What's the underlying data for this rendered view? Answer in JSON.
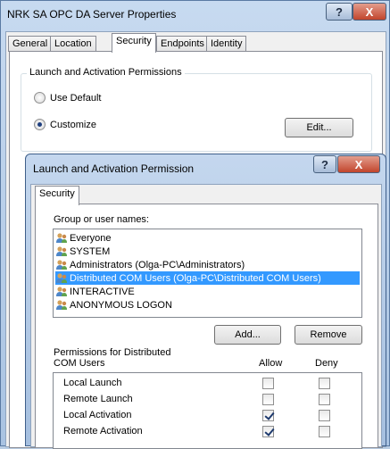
{
  "outer_window": {
    "title": "NRK SA OPC DA Server Properties",
    "help_button": "?",
    "close_button": "X",
    "tabs": [
      "General",
      "Location",
      "Security",
      "Endpoints",
      "Identity"
    ],
    "active_tab": "Security",
    "group_title": "Launch and Activation Permissions",
    "radio_use_default": "Use Default",
    "radio_customize": "Customize",
    "selected_radio": "Customize",
    "edit_button": "Edit..."
  },
  "dialog": {
    "title": "Launch and Activation Permission",
    "help_button": "?",
    "close_button": "X",
    "tab": "Security",
    "group_label": "Group or user names:",
    "users": [
      {
        "name": "Everyone",
        "selected": false
      },
      {
        "name": "SYSTEM",
        "selected": false
      },
      {
        "name": "Administrators (Olga-PC\\Administrators)",
        "selected": false
      },
      {
        "name": "Distributed COM Users (Olga-PC\\Distributed COM Users)",
        "selected": true
      },
      {
        "name": "INTERACTIVE",
        "selected": false
      },
      {
        "name": "ANONYMOUS LOGON",
        "selected": false
      }
    ],
    "add_button": "Add...",
    "remove_button": "Remove",
    "permissions_label": "Permissions for Distributed COM Users",
    "col_allow": "Allow",
    "col_deny": "Deny",
    "permissions": [
      {
        "name": "Local Launch",
        "allow": false,
        "deny": false
      },
      {
        "name": "Remote Launch",
        "allow": false,
        "deny": false
      },
      {
        "name": "Local Activation",
        "allow": true,
        "deny": false
      },
      {
        "name": "Remote Activation",
        "allow": true,
        "deny": false
      }
    ]
  }
}
